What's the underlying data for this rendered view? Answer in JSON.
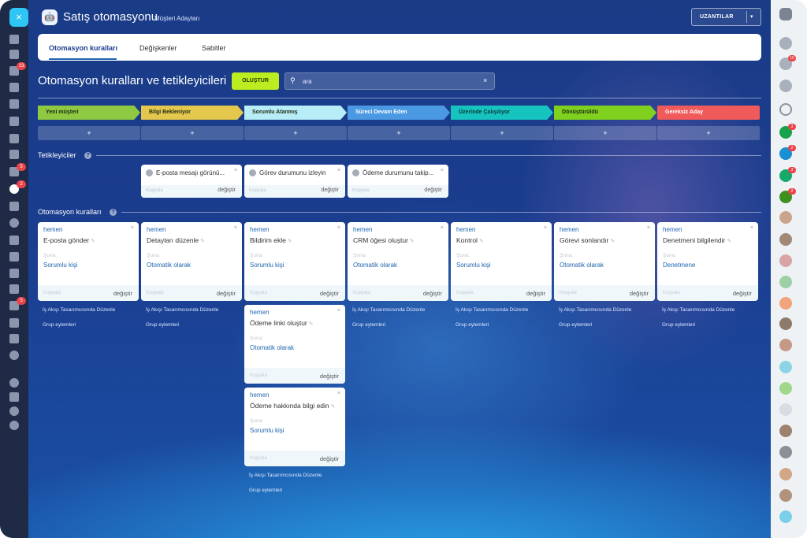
{
  "header": {
    "close_glyph": "×",
    "logo_glyph": "🤖",
    "title": "Satış otomasyonu",
    "subtitle": "Müşteri Adayları",
    "extensions_label": "UZANTILAR",
    "extensions_arrow": "▾"
  },
  "tabs": [
    {
      "label": "Otomasyon kuralları",
      "active": true
    },
    {
      "label": "Değişkenler",
      "active": false
    },
    {
      "label": "Sabitler",
      "active": false
    }
  ],
  "toolbar": {
    "section_title": "Otomasyon kuralları ve tetikleyicileri",
    "create_label": "OLUŞTUR",
    "search_value": "",
    "search_placeholder": "ara",
    "search_icon_glyph": "⚲",
    "clear_glyph": "×"
  },
  "stages": [
    {
      "label": "Yeni müşteri",
      "color": "#8ec941",
      "add_glyph": "+"
    },
    {
      "label": "Bilgi Bekleniyor",
      "color": "#e4c84d",
      "add_glyph": "+"
    },
    {
      "label": "Sorumlu Atanmış",
      "color": "#b8ecf6",
      "add_glyph": "+"
    },
    {
      "label": "Süreci Devam Eden",
      "color": "#4b99e2",
      "add_glyph": "+"
    },
    {
      "label": "Üzerinde Çalışılıyor",
      "color": "#17c3bf",
      "add_glyph": "+"
    },
    {
      "label": "Dönüştürüldü",
      "color": "#7fd11e",
      "add_glyph": "+"
    },
    {
      "label": "Gereksiz Aday",
      "color": "#f15a5a",
      "add_glyph": "+"
    }
  ],
  "triggers_section": {
    "title": "Tetikleyiciler",
    "help_glyph": "?"
  },
  "triggers": [
    {
      "name": "E-posta mesajı görünü...",
      "copy": "Kopyala",
      "change": "değiştir",
      "close": "×"
    },
    {
      "name": "Görev durumunu izleyin",
      "copy": "Kopyala",
      "change": "değiştir",
      "close": "×"
    },
    {
      "name": "Ödeme durumunu takip...",
      "copy": "Kopyala",
      "change": "değiştir",
      "close": "×"
    }
  ],
  "rules_section": {
    "title": "Otomasyon kuralları",
    "help_glyph": "?"
  },
  "rule_labels": {
    "when": "hemen",
    "to": "Şuna:",
    "copy": "Kopyala",
    "change": "değiştir",
    "close": "×",
    "pen": "✎"
  },
  "rules": [
    {
      "name": "E-posta gönder",
      "target": "Sorumlu kişi"
    },
    {
      "name": "Detayları düzenle",
      "target": "Otomatik olarak"
    },
    {
      "name": "Bildirim ekle",
      "target": "Sorumlu kişi"
    },
    {
      "name": "CRM öğesi oluştur",
      "target": "Otomatik olarak"
    },
    {
      "name": "Kontrol",
      "target": "Sorumlu kişi"
    },
    {
      "name": "Görevi sonlandır",
      "target": "Otomatik olarak"
    },
    {
      "name": "Denetmeni bilgilendir",
      "target": "Denetmene"
    },
    {
      "name": "Ödeme linki oluştur",
      "target": "Otomatik olarak"
    },
    {
      "name": "Ödeme hakkında bilgi edin",
      "target": "Sorumlu kişi"
    }
  ],
  "column_links": {
    "designer": "İş Akışı Tasarımcısında Düzenle",
    "group": "Grup eylemleri"
  },
  "left_sidebar": {
    "icons": [
      "play-icon",
      "inbox-icon",
      "chat-icon",
      "calendar-icon",
      "document-icon",
      "drive-icon",
      "mail-icon",
      "contacts-icon",
      "tasks-icon",
      "crm-icon",
      "company-icon",
      "sites-icon",
      "shop-icon",
      "sign-icon",
      "inventory-icon",
      "automation-icon",
      "store-icon",
      "help-icon",
      "structure-icon",
      "settings-icon",
      "add-icon"
    ],
    "badges": {
      "chat": "13",
      "tasks": "5",
      "crm": "2",
      "automation": "5"
    }
  },
  "right_sidebar": {
    "badges": {
      "notifications": "10",
      "open_line_1": "3",
      "open_line_2": "2",
      "open_line_3": "3",
      "open_line_4": "2"
    }
  }
}
